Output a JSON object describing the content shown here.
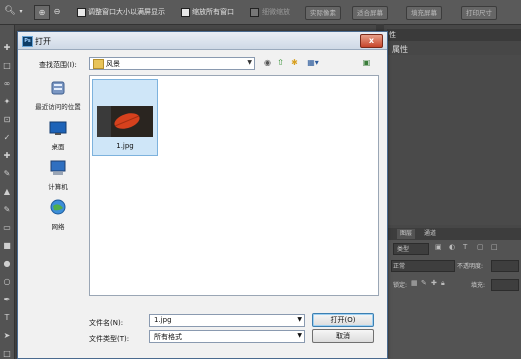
{
  "options_bar": {
    "resize_windows_label": "调整窗口大小以满屏显示",
    "zoom_all_label": "缩放所有窗口",
    "scrubby_zoom_label": "细微缩放",
    "actual_pixels_button": "实际像素",
    "fit_screen_button": "适合屏幕",
    "fill_screen_button": "填充屏幕",
    "print_size_button": "打印尺寸"
  },
  "right_panel": {
    "header_label": "性",
    "properties_title": "属性",
    "layers_tab": "图层",
    "channels_tab": "通道",
    "kind_label": "类型",
    "blend_label": "正常",
    "opacity_label": "不透明度:",
    "lock_label": "锁定:",
    "fill_label": "填充:"
  },
  "dialog": {
    "title": "打开",
    "close_glyph": "x",
    "look_in_label": "查找范围(I):",
    "look_in_value": "风景",
    "places": [
      {
        "label": "最近访问的位置",
        "icon": "recent-places-icon"
      },
      {
        "label": "桌面",
        "icon": "desktop-icon"
      },
      {
        "label": "计算机",
        "icon": "computer-icon"
      },
      {
        "label": "网络",
        "icon": "network-icon"
      }
    ],
    "files": [
      {
        "name": "1.jpg"
      }
    ],
    "file_name_label": "文件名(N):",
    "file_name_value": "1.jpg",
    "file_type_label": "文件类型(T):",
    "file_type_value": "所有格式",
    "open_button": "打开(O)",
    "cancel_button": "取消"
  },
  "colors": {
    "ps_background": "#474747",
    "dialog_background": "#f1f1f1",
    "selection": "#cfe6f8",
    "close_red": "#c6452b"
  }
}
